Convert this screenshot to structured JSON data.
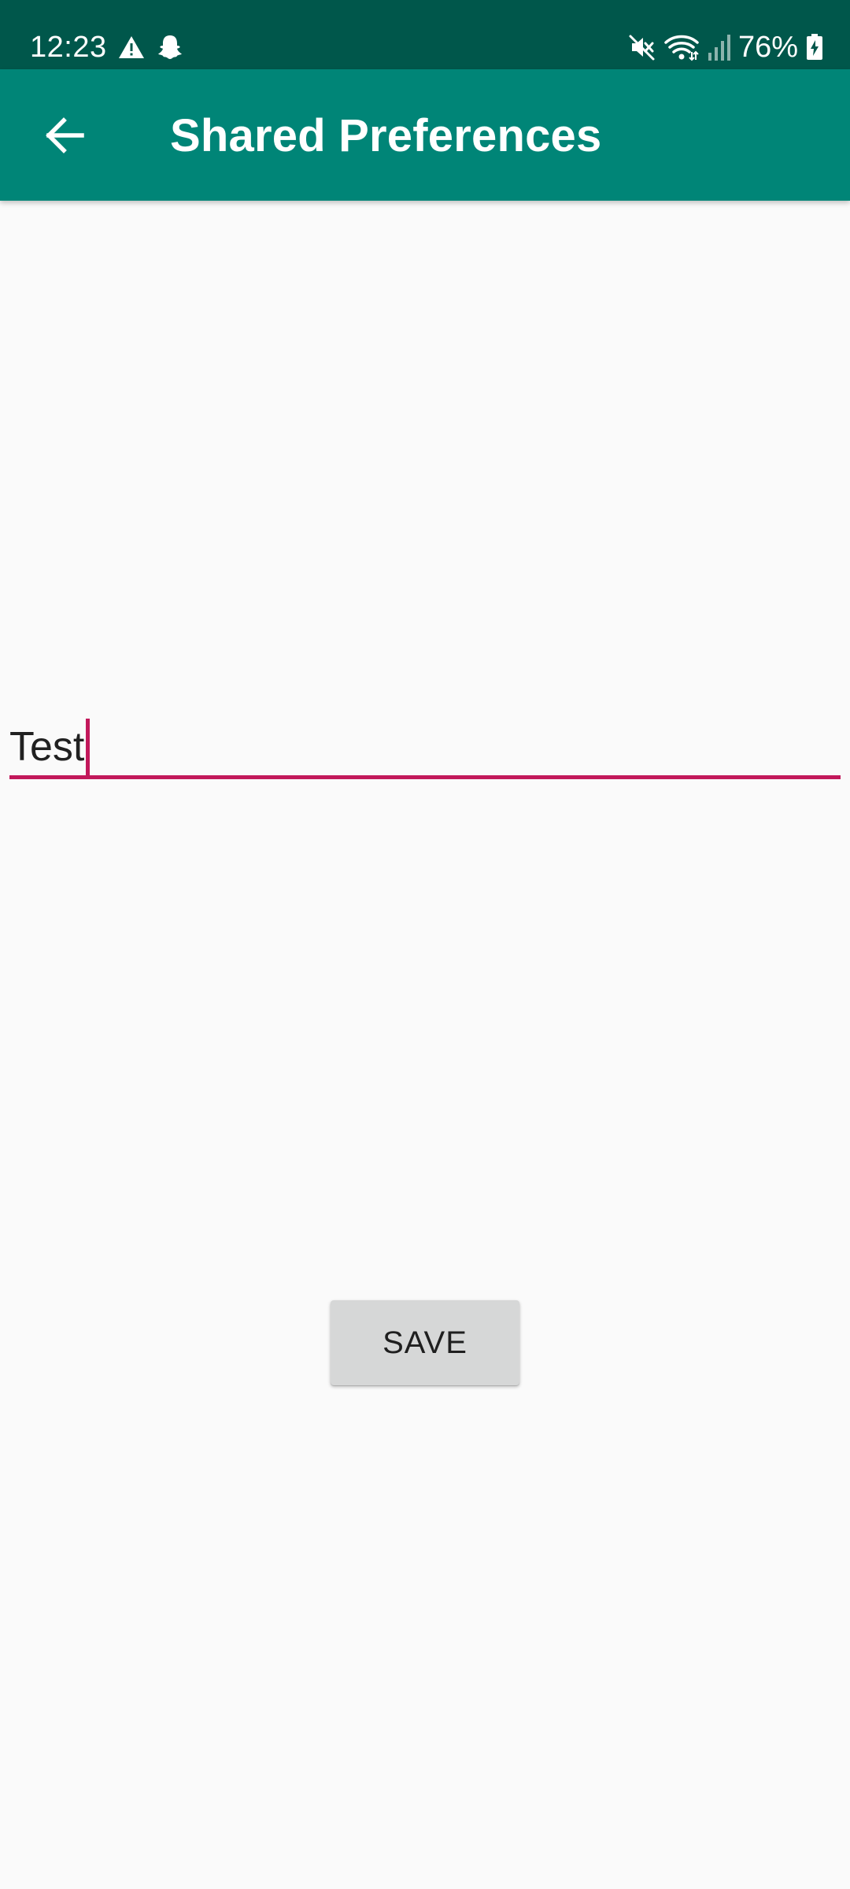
{
  "status_bar": {
    "time": "12:23",
    "battery_percent": "76%",
    "left_icons": [
      "warning-icon",
      "snapchat-icon"
    ],
    "right_icons": [
      "mute-icon",
      "wifi-icon",
      "signal-icon",
      "battery-icon"
    ],
    "background": "#00574b"
  },
  "app_bar": {
    "title": "Shared Preferences",
    "back_icon": "arrow-back-icon",
    "background": "#008577"
  },
  "text_field": {
    "value": "Test",
    "accent": "#c2185b"
  },
  "save_button": {
    "label": "SAVE"
  }
}
